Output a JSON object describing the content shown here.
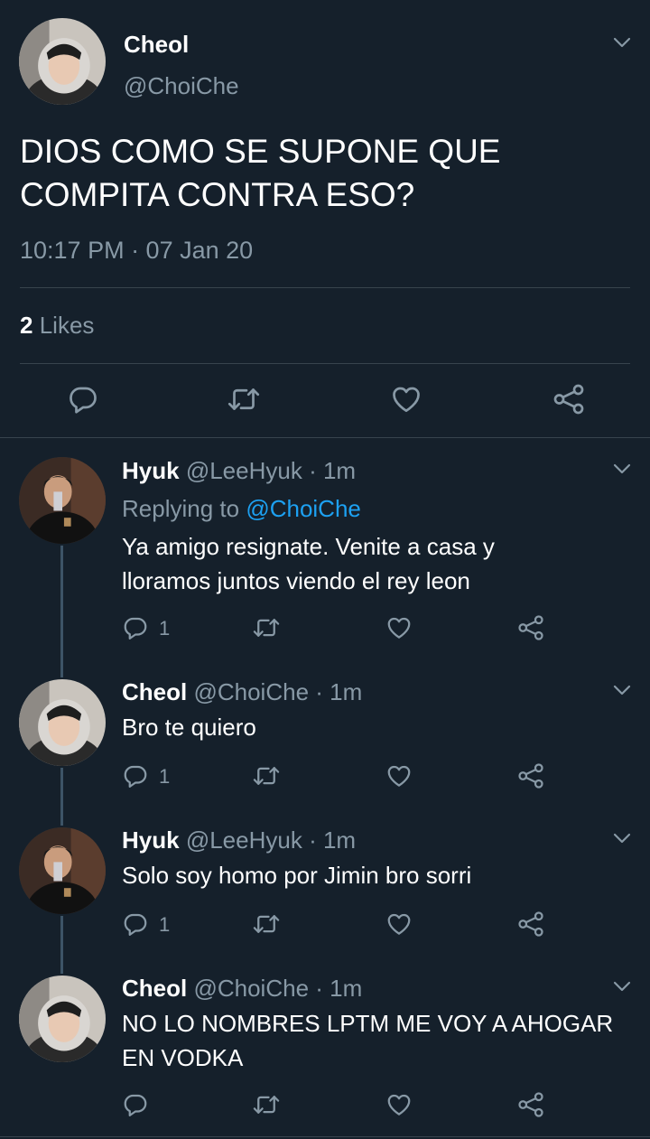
{
  "main_tweet": {
    "display_name": "Cheol",
    "handle": "@ChoiChe",
    "text_line1": "DIOS COMO SE SUPONE QUE",
    "text_line2": "COMPITA CONTRA ESO?",
    "timestamp": "10:17 PM · 07 Jan 20",
    "likes_count": "2",
    "likes_label": "Likes"
  },
  "replies": [
    {
      "display_name": "Hyuk",
      "handle": "@LeeHyuk",
      "sep": "·",
      "time": "1m",
      "replying_prefix": "Replying to",
      "replying_handle": "@ChoiChe",
      "text_line1": "Ya amigo resignate. Venite a casa y",
      "text_line2": "lloramos juntos viendo el rey leon",
      "reply_count": "1"
    },
    {
      "display_name": "Cheol",
      "handle": "@ChoiChe",
      "sep": "·",
      "time": "1m",
      "text_line1": "Bro te quiero",
      "reply_count": "1"
    },
    {
      "display_name": "Hyuk",
      "handle": "@LeeHyuk",
      "sep": "·",
      "time": "1m",
      "text_line1": "Solo soy homo por Jimin bro sorri",
      "reply_count": "1"
    },
    {
      "display_name": "Cheol",
      "handle": "@ChoiChe",
      "sep": "·",
      "time": "1m",
      "text_line1": "NO LO NOMBRES LPTM ME VOY A AHOGAR",
      "text_line2": "EN VODKA",
      "reply_count": ""
    }
  ],
  "colors": {
    "background": "#15202b",
    "muted": "#8899a6",
    "link": "#1da1f2",
    "divider": "#38444d"
  },
  "icons": [
    "chevron-down-icon",
    "reply-icon",
    "retweet-icon",
    "like-icon",
    "share-icon"
  ]
}
